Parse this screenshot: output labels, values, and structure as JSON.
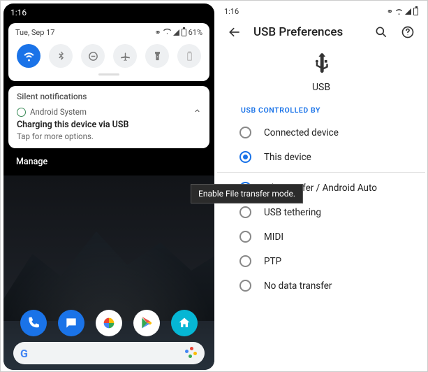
{
  "left": {
    "clock": "1:16",
    "date": "Tue, Sep 17",
    "battery_pct": "61%",
    "qs": [
      "wifi",
      "bluetooth",
      "dnd",
      "airplane",
      "flashlight",
      "battery"
    ],
    "silent_header": "Silent notifications",
    "notif": {
      "app": "Android System",
      "title": "Charging this device via USB",
      "sub": "Tap for more options."
    },
    "manage": "Manage"
  },
  "right": {
    "clock": "1:16",
    "title": "USB Preferences",
    "hero_label": "USB",
    "section1": "USB CONTROLLED BY",
    "controlled": [
      {
        "label": "Connected device",
        "selected": false
      },
      {
        "label": "This device",
        "selected": true
      }
    ],
    "usage": [
      {
        "label": "File transfer / Android Auto",
        "selected": true
      },
      {
        "label": "USB tethering",
        "selected": false
      },
      {
        "label": "MIDI",
        "selected": false
      },
      {
        "label": "PTP",
        "selected": false
      },
      {
        "label": "No data transfer",
        "selected": false
      }
    ]
  },
  "tooltip": "Enable File transfer mode."
}
